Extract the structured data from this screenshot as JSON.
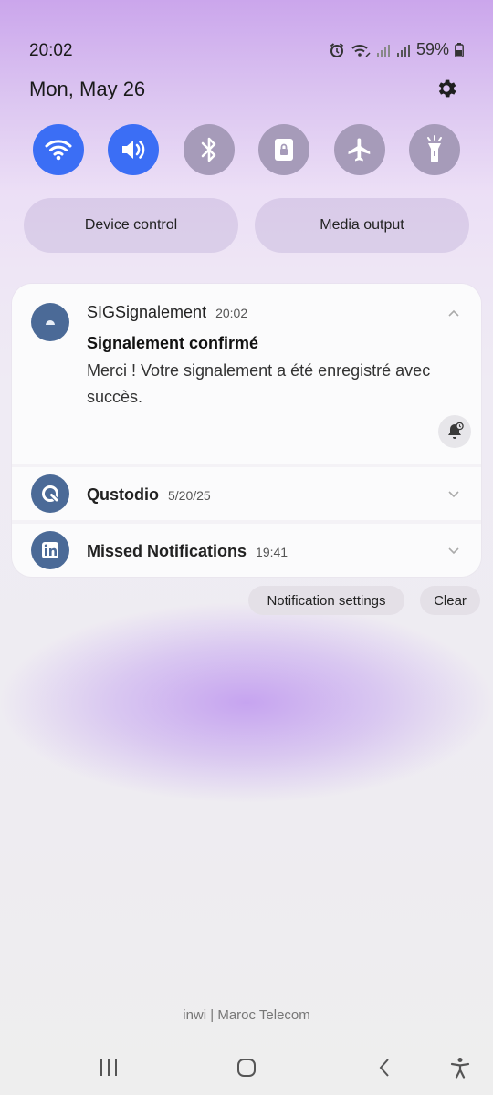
{
  "status_bar": {
    "time": "20:02",
    "battery": "59%",
    "icons": [
      "alarm-icon",
      "wifi-calling-icon",
      "signal-icon",
      "signal-icon",
      "battery-icon"
    ]
  },
  "header": {
    "date": "Mon, May 26",
    "settings_icon": "gear-icon"
  },
  "quick_toggles": [
    {
      "icon": "wifi-icon",
      "active": true
    },
    {
      "icon": "sound-icon",
      "active": true
    },
    {
      "icon": "bluetooth-icon",
      "active": false
    },
    {
      "icon": "rotation-lock-icon",
      "active": false
    },
    {
      "icon": "airplane-icon",
      "active": false
    },
    {
      "icon": "flashlight-icon",
      "active": false
    }
  ],
  "panel_buttons": {
    "device_control": "Device control",
    "media_output": "Media output"
  },
  "notifications": [
    {
      "app": "SIGSignalement",
      "time": "20:02",
      "title": "Signalement confirmé",
      "body": "Merci ! Votre signalement a été enregistré avec succès.",
      "expanded": true
    },
    {
      "app": "Qustodio",
      "time": "5/20/25",
      "expanded": false
    },
    {
      "app": "Missed Notifications",
      "time": "19:41",
      "expanded": false
    }
  ],
  "notification_actions": {
    "settings": "Notification settings",
    "clear": "Clear"
  },
  "carrier": "inwi | Maroc Telecom",
  "colors": {
    "toggle_on": "#3b6ef5",
    "toggle_off": "#a69bb9",
    "app_icon": "#4b6a97"
  }
}
